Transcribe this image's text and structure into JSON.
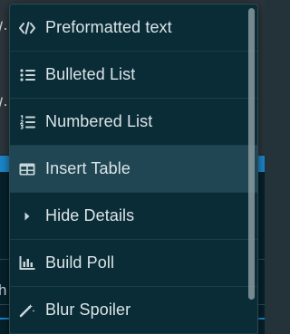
{
  "background": {
    "frag_top": "/·",
    "frag_mid": "/·",
    "frag_low": "h"
  },
  "menu": {
    "items": [
      {
        "label": "Preformatted text",
        "icon": "code-icon"
      },
      {
        "label": "Bulleted List",
        "icon": "bulleted-list-icon"
      },
      {
        "label": "Numbered List",
        "icon": "numbered-list-icon"
      },
      {
        "label": "Insert Table",
        "icon": "table-icon"
      },
      {
        "label": "Hide Details",
        "icon": "caret-right-icon"
      },
      {
        "label": "Build Poll",
        "icon": "bar-chart-icon"
      },
      {
        "label": "Blur Spoiler",
        "icon": "magic-wand-icon"
      }
    ]
  },
  "colors": {
    "menu_bg": "#0a2c36",
    "highlight_bg": "#1f4652",
    "accent_blue": "#1b86c8"
  }
}
